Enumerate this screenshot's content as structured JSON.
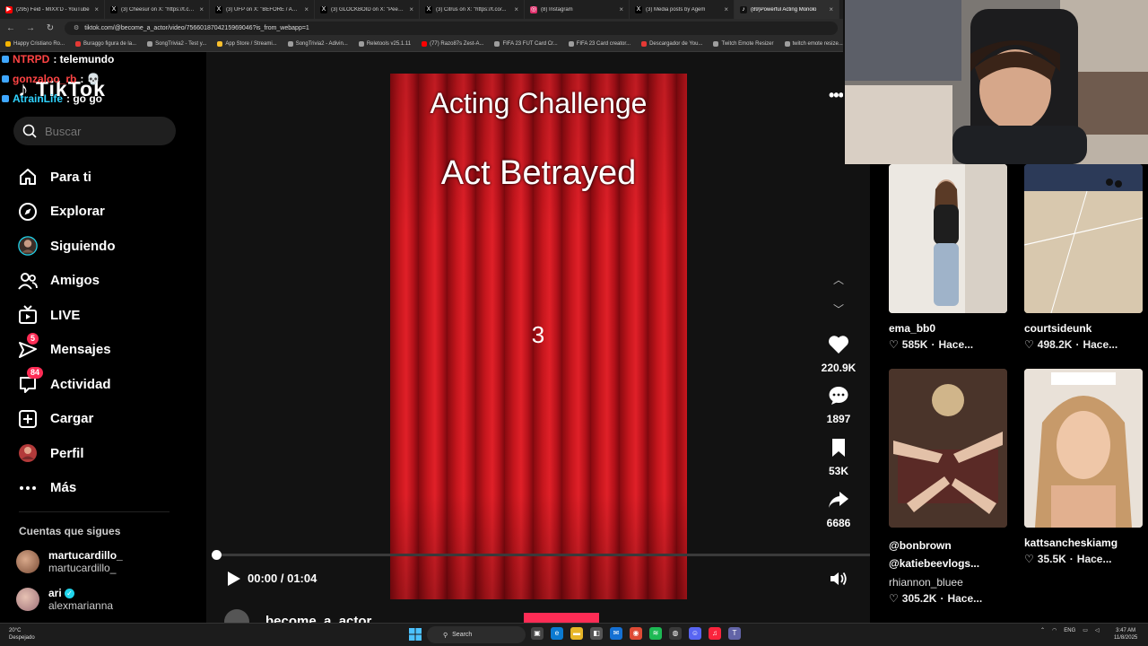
{
  "browser": {
    "tabs": [
      {
        "label": "(295) Feid - MIXX'D - YouTube",
        "color": "#ff0000",
        "glyph": "▶"
      },
      {
        "label": "(3) Cheesur on X: \"https://t.co/...",
        "color": "#000000",
        "glyph": "X"
      },
      {
        "label": "(3) UFP on X: \"BEFORE / AFTER",
        "color": "#000000",
        "glyph": "X"
      },
      {
        "label": "(3) GLOCKBOID on X: \"Peep the",
        "color": "#000000",
        "glyph": "X"
      },
      {
        "label": "(3) Citrus on X: \"https://t.co/...",
        "color": "#000000",
        "glyph": "X"
      },
      {
        "label": "(8) Instagram",
        "color": "#e1306c",
        "glyph": "◎"
      },
      {
        "label": "(3) Media posts by Agem",
        "color": "#000000",
        "glyph": "X"
      },
      {
        "label": "(89)Powerful Acting Monolo",
        "color": "#111111",
        "glyph": "♪"
      }
    ],
    "url": "tiktok.com/@become_a_actor/video/7566018704215969046?is_from_webapp=1",
    "bookmarks": [
      {
        "label": "Happy Cristiano Ro...",
        "color": "#f4b400"
      },
      {
        "label": "Buraggo figura de la...",
        "color": "#e53935"
      },
      {
        "label": "SongTrivia2 - Test y...",
        "color": "#9e9e9e"
      },
      {
        "label": "App Store / Streami...",
        "color": "#fbc02d"
      },
      {
        "label": "SongTrivia2 - Adivin...",
        "color": "#9e9e9e"
      },
      {
        "label": "Reletools v25.1.11",
        "color": "#9e9e9e"
      },
      {
        "label": "(77) Razo87s Zest-A...",
        "color": "#ff0000"
      },
      {
        "label": "FIFA 23 FUT Card Cr...",
        "color": "#9e9e9e"
      },
      {
        "label": "FIFA 23 Card creator...",
        "color": "#9e9e9e"
      },
      {
        "label": "Descargador de You...",
        "color": "#e53935"
      },
      {
        "label": "Twitch Emote Resizer",
        "color": "#9e9e9e"
      },
      {
        "label": "twitch emote resize...",
        "color": "#9e9e9e"
      }
    ]
  },
  "chat": [
    {
      "user": "NTRPD",
      "message": ": telemundo",
      "user_color": "#ff4444"
    },
    {
      "user": "gonzaloo_rb",
      "message": ": 💀",
      "user_color": "#ff4444"
    },
    {
      "user": "AtrainLife",
      "message": ": go go",
      "user_color": "#2fd3ff"
    }
  ],
  "sidebar": {
    "logo": "TikTok",
    "search_placeholder": "Buscar",
    "items": [
      {
        "label": "Para ti",
        "icon": "home-icon"
      },
      {
        "label": "Explorar",
        "icon": "compass-icon"
      },
      {
        "label": "Siguiendo",
        "icon": "following-avatar-icon"
      },
      {
        "label": "Amigos",
        "icon": "friends-icon"
      },
      {
        "label": "LIVE",
        "icon": "live-tv-icon"
      },
      {
        "label": "Mensajes",
        "icon": "send-icon",
        "badge": "5"
      },
      {
        "label": "Actividad",
        "icon": "inbox-icon",
        "badge": "84"
      },
      {
        "label": "Cargar",
        "icon": "upload-plus-icon"
      },
      {
        "label": "Perfil",
        "icon": "profile-avatar-icon"
      },
      {
        "label": "Más",
        "icon": "more-dots-icon"
      }
    ],
    "following_title": "Cuentas que sigues",
    "accounts": [
      {
        "name": "martucardillo_",
        "handle": "martucardillo_",
        "verified": false
      },
      {
        "name": "ari",
        "handle": "alexmarianna",
        "verified": true
      }
    ]
  },
  "video": {
    "title_line1": "Acting Challenge",
    "title_line2": "Act Betrayed",
    "countdown": "3",
    "likes": "220.9K",
    "comments": "1897",
    "saves": "53K",
    "shares": "6686",
    "time": "00:00 / 01:04",
    "progress": 0,
    "author": "become_a_actor"
  },
  "grid": [
    {
      "name": "ema_bb0",
      "likes": "585K",
      "time": "Hace...",
      "sub": ""
    },
    {
      "name": "courtsideunk",
      "likes": "498.2K",
      "time": "Hace...",
      "sub": ""
    },
    {
      "name": "@bonbrown @katiebeevlogs...",
      "likes": "305.2K",
      "time": "Hace...",
      "sub": "rhiannon_bluee"
    },
    {
      "name": "kattsancheskiamg",
      "likes": "35.5K",
      "time": "Hace...",
      "sub": ""
    }
  ],
  "taskbar": {
    "weather_temp": "20°C",
    "weather_desc": "Despejado",
    "search_label": "Search",
    "lang": "ENG",
    "time": "3:47 AM",
    "date": "11/8/2025"
  },
  "colors": {
    "accent": "#fe2c55",
    "verified": "#20d5ec"
  }
}
